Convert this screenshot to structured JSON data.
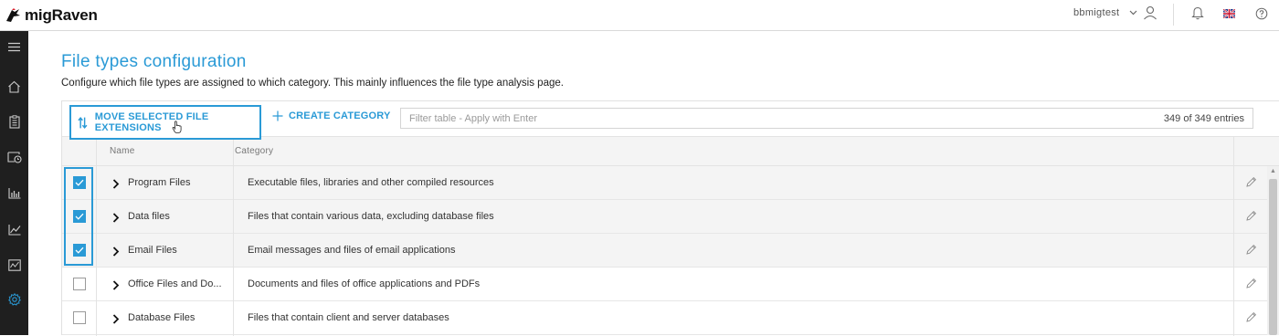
{
  "app": {
    "name": "migRaven"
  },
  "topbar": {
    "username": "bbmigtest",
    "icons": [
      "chevron-down-icon",
      "user-icon",
      "bell-icon",
      "uk-flag-icon",
      "help-icon"
    ]
  },
  "sidenav": {
    "items": [
      "menu-icon",
      "home-icon",
      "clipboard-icon",
      "folder-clock-icon",
      "bar-chart-icon",
      "line-chart-icon",
      "activity-icon",
      "settings-icon"
    ],
    "active": "settings-icon"
  },
  "page": {
    "title": "File types configuration",
    "description": "Configure which file types are assigned to which category. This mainly influences the file type analysis page."
  },
  "toolbar": {
    "move_label": "MOVE SELECTED FILE EXTENSIONS",
    "create_label": "CREATE CATEGORY",
    "filter_placeholder": "Filter table - Apply with Enter",
    "entries": "349 of 349 entries"
  },
  "table": {
    "columns": [
      "Name",
      "Category"
    ],
    "rows": [
      {
        "name": "Program Files",
        "category": "Executable files, libraries and other compiled resources",
        "checked": true
      },
      {
        "name": "Data files",
        "category": "Files that contain various data, excluding database files",
        "checked": true
      },
      {
        "name": "Email Files",
        "category": "Email messages and files of email applications",
        "checked": true
      },
      {
        "name": "Office Files and Do...",
        "category": "Documents and files of office applications and PDFs",
        "checked": false
      },
      {
        "name": "Database Files",
        "category": "Files that contain client and server databases",
        "checked": false
      }
    ]
  },
  "colors": {
    "accent": "#2a9ad6",
    "sidebar": "#1f1f1f"
  }
}
